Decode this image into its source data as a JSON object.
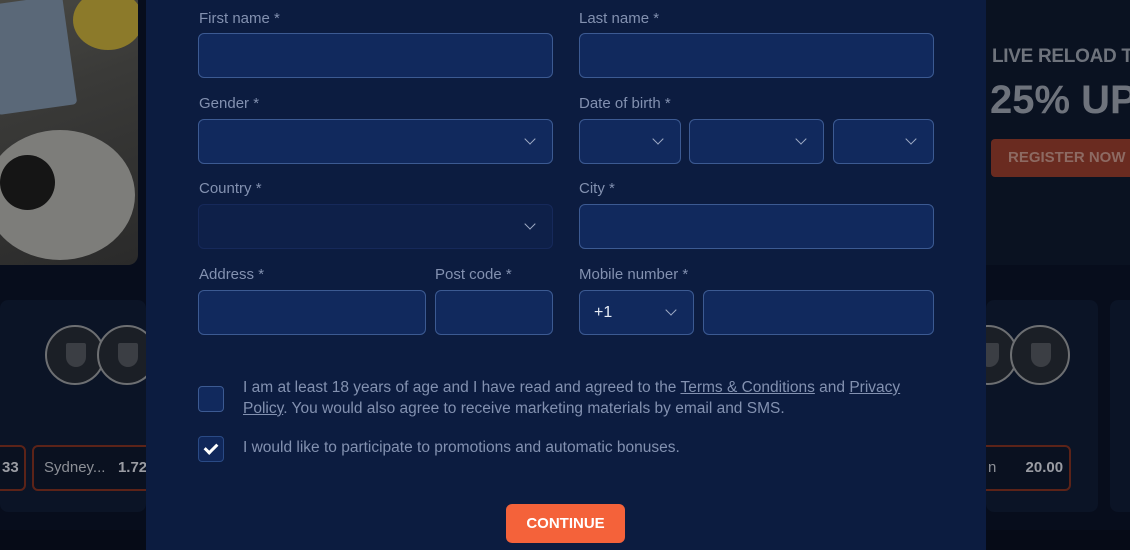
{
  "background": {
    "promo_title": "LIVE RELOAD T",
    "promo_big": "25% UP",
    "promo_button": "REGISTER NOW",
    "odds": [
      {
        "team": "",
        "value": "33"
      },
      {
        "team": "Sydney...",
        "value": "1.72"
      },
      {
        "team": "n",
        "value": "20.00"
      }
    ]
  },
  "form": {
    "first_name": {
      "label": "First name *",
      "value": ""
    },
    "last_name": {
      "label": "Last name *",
      "value": ""
    },
    "gender": {
      "label": "Gender *",
      "value": ""
    },
    "dob": {
      "label": "Date of birth *",
      "day": "",
      "month": "",
      "year": ""
    },
    "country": {
      "label": "Country *",
      "value": ""
    },
    "city": {
      "label": "City *",
      "value": ""
    },
    "address": {
      "label": "Address *",
      "value": ""
    },
    "post_code": {
      "label": "Post code *",
      "value": ""
    },
    "mobile": {
      "label": "Mobile number *",
      "prefix": "+1",
      "value": ""
    },
    "consent": {
      "checked": false,
      "text_before": "I am at least 18 years of age and I have read and agreed to the ",
      "terms_link": "Terms & Conditions",
      "text_and": " and ",
      "privacy_link": "Privacy Policy",
      "text_after": ". You would also agree to receive marketing materials by email and SMS."
    },
    "promotions": {
      "checked": true,
      "text": "I would like to participate to promotions and automatic bonuses."
    },
    "continue_label": "CONTINUE"
  }
}
